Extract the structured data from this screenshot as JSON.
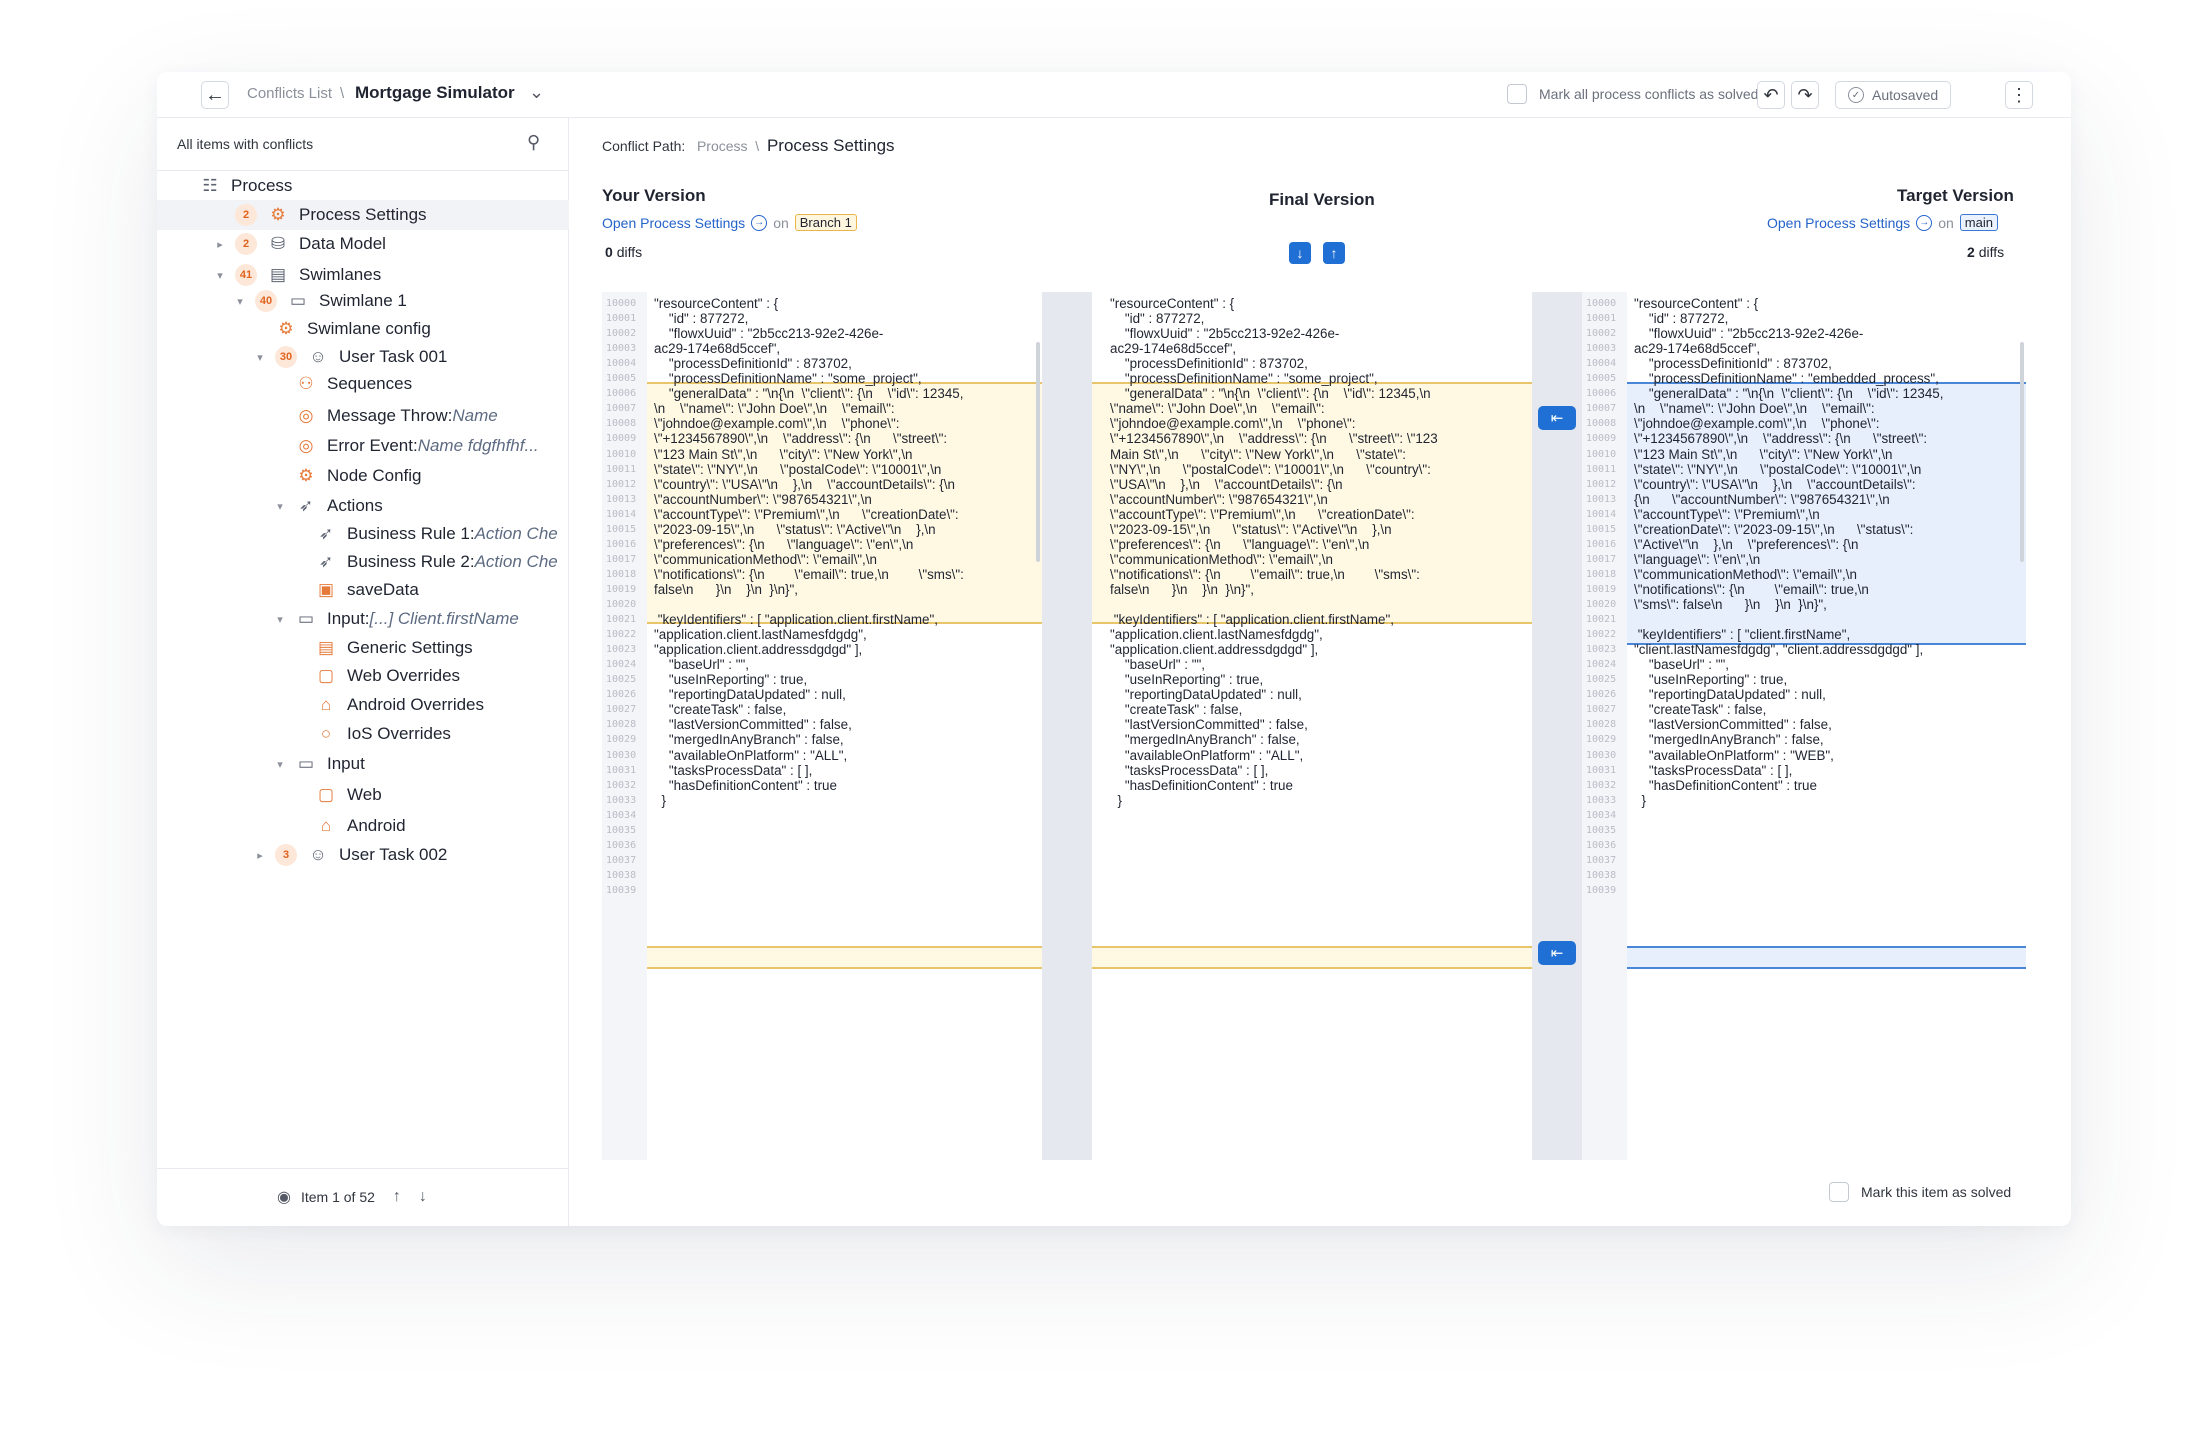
{
  "header": {
    "back_icon": "arrow-left-icon",
    "crumb_root": "Conflicts List",
    "crumb_sep": "\\",
    "title": "Mortgage Simulator",
    "mark_all_label": "Mark all process conflicts as solved",
    "autosaved_label": "Autosaved"
  },
  "sidebar": {
    "filter_label": "All items with conflicts",
    "tree": [
      {
        "label": "Process",
        "level": 0,
        "icon": "process-icon"
      },
      {
        "label": "Process Settings",
        "level": 1,
        "badge": "2",
        "icon": "gear-icon",
        "selected": true
      },
      {
        "label": "Data Model",
        "level": 1,
        "badge": "2",
        "icon": "database-icon",
        "arrow": "right"
      },
      {
        "label": "Swimlanes",
        "level": 1,
        "badge": "41",
        "icon": "swimlanes-icon",
        "arrow": "down"
      },
      {
        "label": "Swimlane 1",
        "level": 2,
        "badge": "40",
        "icon": "swimlane-icon",
        "arrow": "down"
      },
      {
        "label": "Swimlane config",
        "level": 3,
        "icon": "gear-icon"
      },
      {
        "label": "User Task 001",
        "level": 3,
        "badge": "30",
        "icon": "user-icon",
        "arrow": "down"
      },
      {
        "label": "Sequences",
        "level": 4,
        "icon": "sequences-icon"
      },
      {
        "label": "Message Throw: ",
        "italic": "Name",
        "level": 4,
        "icon": "message-icon"
      },
      {
        "label": "Error Event: ",
        "italic": "Name fdgfhfhf...",
        "level": 4,
        "icon": "error-icon"
      },
      {
        "label": "Node Config",
        "level": 4,
        "icon": "gear-icon"
      },
      {
        "label": "Actions",
        "level": 4,
        "icon": "cursor-icon",
        "arrow": "down"
      },
      {
        "label": "Business Rule 1: ",
        "italic": "Action Che",
        "level": 5,
        "icon": "cursor-icon"
      },
      {
        "label": "Business Rule 2: ",
        "italic": "Action Che",
        "level": 5,
        "icon": "cursor-icon"
      },
      {
        "label": "saveData",
        "level": 5,
        "icon": "save-icon"
      },
      {
        "label": "Input: ",
        "italic": "[...] Client.firstName",
        "level": 4,
        "icon": "input-icon",
        "arrow": "down"
      },
      {
        "label": "Generic Settings",
        "level": 5,
        "icon": "settings-icon"
      },
      {
        "label": "Web Overrides",
        "level": 5,
        "icon": "monitor-icon"
      },
      {
        "label": "Android Overrides",
        "level": 5,
        "icon": "android-icon"
      },
      {
        "label": "IoS Overrides",
        "level": 5,
        "icon": "apple-icon"
      },
      {
        "label": "Input",
        "level": 4,
        "icon": "input-icon",
        "arrow": "down"
      },
      {
        "label": "Web",
        "level": 5,
        "icon": "monitor-icon"
      },
      {
        "label": "Android",
        "level": 5,
        "icon": "android-icon"
      },
      {
        "label": "User Task 002",
        "level": 3,
        "badge": "3",
        "icon": "user-icon",
        "arrow": "right"
      }
    ],
    "footer": {
      "label": "Item 1 of 52"
    }
  },
  "main": {
    "path_label": "Conflict Path:",
    "path_root": "Process",
    "path_sep": "\\",
    "path_current": "Process Settings",
    "your": {
      "title": "Your Version",
      "link": "Open Process Settings",
      "on": "on",
      "branch": "Branch 1",
      "diffs": "0",
      "diffs_label": "diffs"
    },
    "final": {
      "title": "Final Version"
    },
    "target": {
      "title": "Target Version",
      "link": "Open Process Settings",
      "on": "on",
      "branch": "main",
      "diffs": "2",
      "diffs_label": "diffs"
    },
    "mark_item_label": "Mark this item as solved",
    "line_numbers": [
      "10000",
      "10001",
      "10002",
      "10003",
      "10004",
      "10005",
      "10006",
      "10007",
      "10008",
      "10009",
      "10010",
      "10011",
      "10012",
      "10013",
      "10014",
      "10015",
      "10016",
      "10017",
      "10018",
      "10019",
      "10020",
      "10021",
      "10022",
      "10023",
      "10024",
      "10025",
      "10026",
      "10027",
      "10028",
      "10029",
      "10030",
      "10031",
      "10032",
      "10033",
      "10034",
      "10035",
      "10036",
      "10037",
      "10038",
      "10039"
    ],
    "your_code": [
      "\"resourceContent\" : {",
      "    \"id\" : 877272,",
      "    \"flowxUuid\" : \"2b5cc213-92e2-426e-",
      "ac29-174e68d5ccef\",",
      "    \"processDefinitionId\" : 873702,",
      "    \"processDefinitionName\" : \"some_project\",",
      "    \"generalData\" : \"\\n{\\n  \\\"client\\\": {\\n    \\\"id\\\": 12345,",
      "\\n    \\\"name\\\": \\\"John Doe\\\",\\n    \\\"email\\\":",
      "\\\"johndoe@example.com\\\",\\n    \\\"phone\\\":",
      "\\\"+1234567890\\\",\\n    \\\"address\\\": {\\n      \\\"street\\\":",
      "\\\"123 Main St\\\",\\n      \\\"city\\\": \\\"New York\\\",\\n",
      "\\\"state\\\": \\\"NY\\\",\\n      \\\"postalCode\\\": \\\"10001\\\",\\n",
      "\\\"country\\\": \\\"USA\\\"\\n    },\\n    \\\"accountDetails\\\": {\\n",
      "\\\"accountNumber\\\": \\\"987654321\\\",\\n",
      "\\\"accountType\\\": \\\"Premium\\\",\\n      \\\"creationDate\\\":",
      "\\\"2023-09-15\\\",\\n      \\\"status\\\": \\\"Active\\\"\\n    },\\n",
      "\\\"preferences\\\": {\\n      \\\"language\\\": \\\"en\\\",\\n",
      "\\\"communicationMethod\\\": \\\"email\\\",\\n",
      "\\\"notifications\\\": {\\n        \\\"email\\\": true,\\n        \\\"sms\\\":",
      "false\\n      }\\n    }\\n  }\\n}\",",
      "",
      " \"keyIdentifiers\" : [ \"application.client.firstName\",",
      "\"application.client.lastNamesfdgdg\",",
      "\"application.client.addressdgdgd\" ],",
      "    \"baseUrl\" : \"\",",
      "    \"useInReporting\" : true,",
      "    \"reportingDataUpdated\" : null,",
      "    \"createTask\" : false,",
      "    \"lastVersionCommitted\" : false,",
      "    \"mergedInAnyBranch\" : false,",
      "    \"availableOnPlatform\" : \"ALL\",",
      "    \"tasksProcessData\" : [ ],",
      "    \"hasDefinitionContent\" : true",
      "  }"
    ],
    "final_code": [
      "\"resourceContent\" : {",
      "    \"id\" : 877272,",
      "    \"flowxUuid\" : \"2b5cc213-92e2-426e-",
      "ac29-174e68d5ccef\",",
      "    \"processDefinitionId\" : 873702,",
      "    \"processDefinitionName\" : \"some_project\",",
      "    \"generalData\" : \"\\n{\\n  \\\"client\\\": {\\n    \\\"id\\\": 12345,\\n",
      "\\\"name\\\": \\\"John Doe\\\",\\n    \\\"email\\\":",
      "\\\"johndoe@example.com\\\",\\n    \\\"phone\\\":",
      "\\\"+1234567890\\\",\\n    \\\"address\\\": {\\n      \\\"street\\\": \\\"123",
      "Main St\\\",\\n      \\\"city\\\": \\\"New York\\\",\\n      \\\"state\\\":",
      "\\\"NY\\\",\\n      \\\"postalCode\\\": \\\"10001\\\",\\n      \\\"country\\\":",
      "\\\"USA\\\"\\n    },\\n    \\\"accountDetails\\\": {\\n",
      "\\\"accountNumber\\\": \\\"987654321\\\",\\n",
      "\\\"accountType\\\": \\\"Premium\\\",\\n      \\\"creationDate\\\":",
      "\\\"2023-09-15\\\",\\n      \\\"status\\\": \\\"Active\\\"\\n    },\\n",
      "\\\"preferences\\\": {\\n      \\\"language\\\": \\\"en\\\",\\n",
      "\\\"communicationMethod\\\": \\\"email\\\",\\n",
      "\\\"notifications\\\": {\\n        \\\"email\\\": true,\\n        \\\"sms\\\":",
      "false\\n      }\\n    }\\n  }\\n}\",",
      "",
      " \"keyIdentifiers\" : [ \"application.client.firstName\",",
      "\"application.client.lastNamesfdgdg\",",
      "\"application.client.addressdgdgd\" ],",
      "    \"baseUrl\" : \"\",",
      "    \"useInReporting\" : true,",
      "    \"reportingDataUpdated\" : null,",
      "    \"createTask\" : false,",
      "    \"lastVersionCommitted\" : false,",
      "    \"mergedInAnyBranch\" : false,",
      "    \"availableOnPlatform\" : \"ALL\",",
      "    \"tasksProcessData\" : [ ],",
      "    \"hasDefinitionContent\" : true",
      "  }"
    ],
    "target_code": [
      "\"resourceContent\" : {",
      "    \"id\" : 877272,",
      "    \"flowxUuid\" : \"2b5cc213-92e2-426e-",
      "ac29-174e68d5ccef\",",
      "    \"processDefinitionId\" : 873702,",
      "    \"processDefinitionName\" : \"embedded_process\",",
      "    \"generalData\" : \"\\n{\\n  \\\"client\\\": {\\n    \\\"id\\\": 12345,",
      "\\n    \\\"name\\\": \\\"John Doe\\\",\\n    \\\"email\\\":",
      "\\\"johndoe@example.com\\\",\\n    \\\"phone\\\":",
      "\\\"+1234567890\\\",\\n    \\\"address\\\": {\\n      \\\"street\\\":",
      "\\\"123 Main St\\\",\\n      \\\"city\\\": \\\"New York\\\",\\n",
      "\\\"state\\\": \\\"NY\\\",\\n      \\\"postalCode\\\": \\\"10001\\\",\\n",
      "\\\"country\\\": \\\"USA\\\"\\n    },\\n    \\\"accountDetails\\\":",
      "{\\n      \\\"accountNumber\\\": \\\"987654321\\\",\\n",
      "\\\"accountType\\\": \\\"Premium\\\",\\n",
      "\\\"creationDate\\\": \\\"2023-09-15\\\",\\n      \\\"status\\\":",
      "\\\"Active\\\"\\n    },\\n    \\\"preferences\\\": {\\n",
      "\\\"language\\\": \\\"en\\\",\\n",
      "\\\"communicationMethod\\\": \\\"email\\\",\\n",
      "\\\"notifications\\\": {\\n        \\\"email\\\": true,\\n",
      "\\\"sms\\\": false\\n      }\\n    }\\n  }\\n}\",",
      "",
      " \"keyIdentifiers\" : [ \"client.firstName\",",
      "\"client.lastNamesfdgdg\", \"client.addressdgdgd\" ],",
      "    \"baseUrl\" : \"\",",
      "    \"useInReporting\" : true,",
      "    \"reportingDataUpdated\" : null,",
      "    \"createTask\" : false,",
      "    \"lastVersionCommitted\" : false,",
      "    \"mergedInAnyBranch\" : false,",
      "    \"availableOnPlatform\" : \"WEB\",",
      "    \"tasksProcessData\" : [ ],",
      "    \"hasDefinitionContent\" : true",
      "  }"
    ]
  },
  "colors": {
    "accent": "#1f6fd4",
    "conflict_yellow": "#fff8e2",
    "conflict_blue": "#e6effb",
    "badge": "#e0631f"
  }
}
